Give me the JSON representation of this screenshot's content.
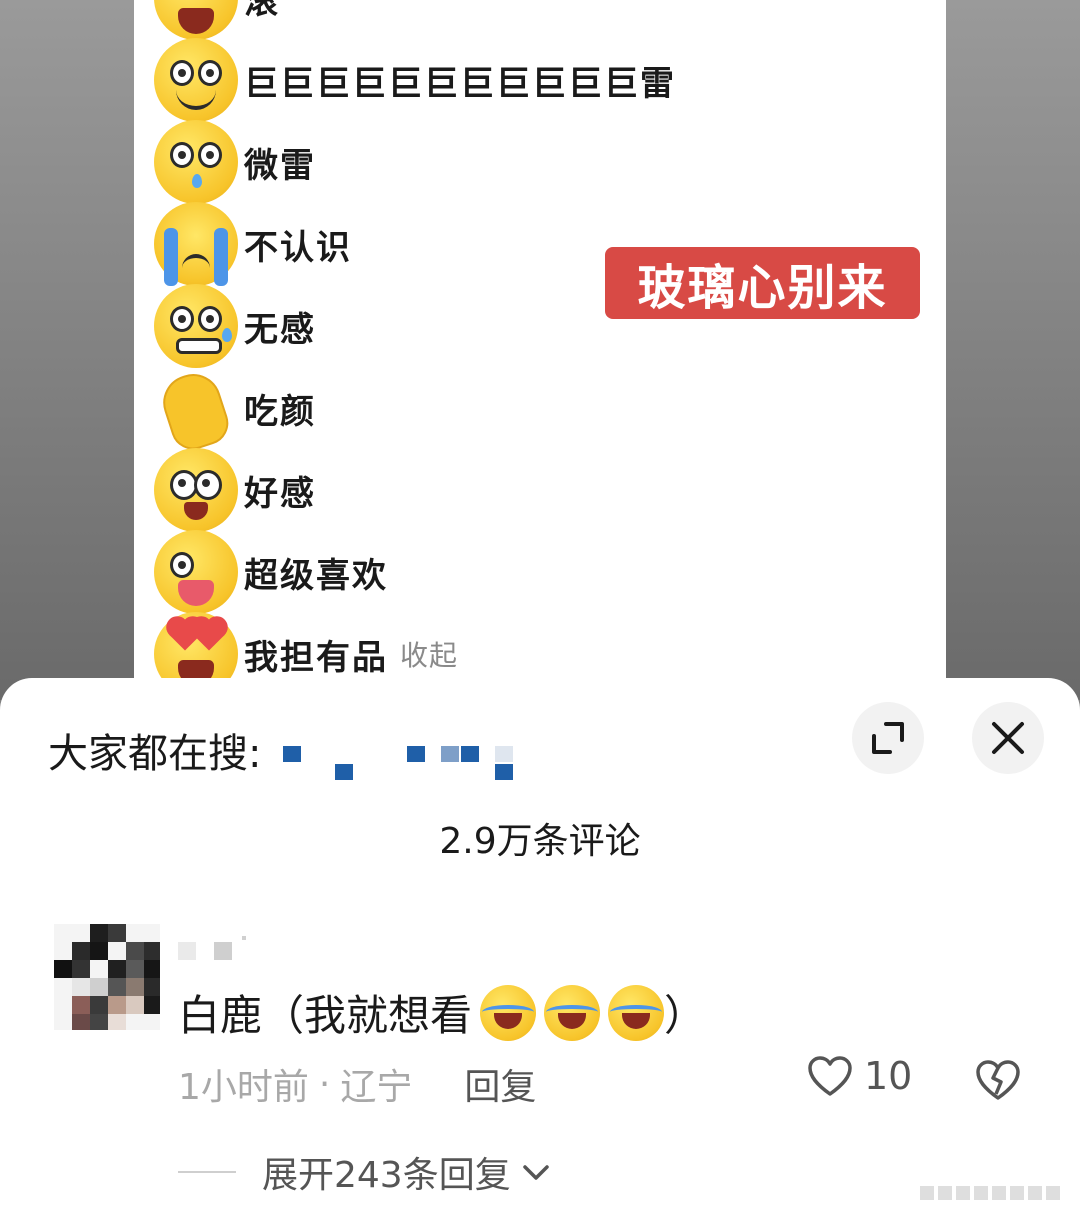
{
  "background_image": {
    "emoji_rows": [
      {
        "label": "滚",
        "icon": "laughing-cry-emoji"
      },
      {
        "label": "巨巨巨巨巨巨巨巨巨巨巨雷",
        "icon": "big-eyes-smile-emoji"
      },
      {
        "label": "微雷",
        "icon": "shocked-sweat-emoji"
      },
      {
        "label": "不认识",
        "icon": "crying-emoji"
      },
      {
        "label": "无感",
        "icon": "nervous-sweat-emoji"
      },
      {
        "label": "吃颜",
        "icon": "clapping-hands-emoji"
      },
      {
        "label": "好感",
        "icon": "teary-eyes-emoji"
      },
      {
        "label": "超级喜欢",
        "icon": "wink-tongue-emoji"
      },
      {
        "label": "我担有品",
        "icon": "heart-eyes-emoji"
      }
    ],
    "collapse_link": "收起",
    "badge_text": "玻璃心别来"
  },
  "sheet": {
    "search_hint": "大家都在搜:",
    "comment_count": "2.9万条评论",
    "comment": {
      "text": "白鹿（我就想看",
      "text_end": "）",
      "laugh_icons": [
        "laughing-cry-emoji",
        "laughing-cry-emoji",
        "laughing-cry-emoji"
      ],
      "time": "1小时前",
      "separator": "·",
      "location": "辽宁",
      "reply_label": "回复",
      "like_count": "10"
    },
    "expand_replies": "展开243条回复"
  },
  "colors": {
    "badge": "#d84a45",
    "redaction": "#1f5fa8"
  }
}
